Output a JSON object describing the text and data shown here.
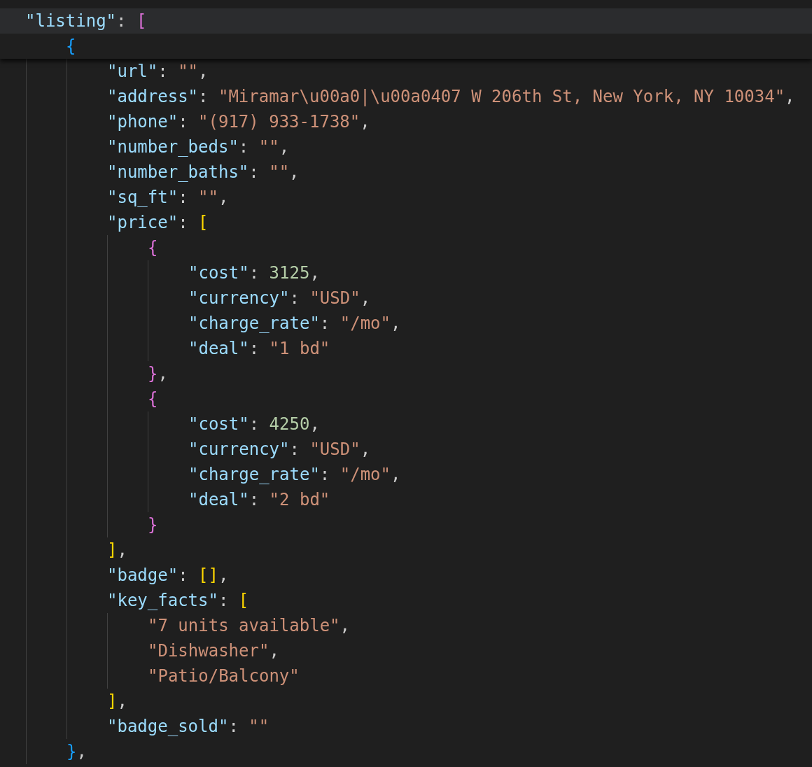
{
  "sticky_lines": [
    {
      "tokens": [
        {
          "text": "\"listing\"",
          "kind": "key"
        },
        {
          "text": ": ",
          "kind": "punct"
        },
        {
          "text": "[",
          "kind": "bracket",
          "color": "#da70d6"
        }
      ]
    },
    {
      "tokens": [
        {
          "text": "{",
          "kind": "bracket",
          "color": "#179fff"
        }
      ]
    }
  ],
  "lines": [
    {
      "tokens": [
        {
          "text": "\"url\"",
          "kind": "key"
        },
        {
          "text": ": ",
          "kind": "punct"
        },
        {
          "text": "\"\"",
          "kind": "string"
        },
        {
          "text": ",",
          "kind": "punct"
        }
      ]
    },
    {
      "tokens": [
        {
          "text": "\"address\"",
          "kind": "key"
        },
        {
          "text": ": ",
          "kind": "punct"
        },
        {
          "text": "\"Miramar\\u00a0|\\u00a0407 W 206th St, New York, NY 10034\"",
          "kind": "string"
        },
        {
          "text": ",",
          "kind": "punct"
        }
      ]
    },
    {
      "tokens": [
        {
          "text": "\"phone\"",
          "kind": "key"
        },
        {
          "text": ": ",
          "kind": "punct"
        },
        {
          "text": "\"(917) 933-1738\"",
          "kind": "string"
        },
        {
          "text": ",",
          "kind": "punct"
        }
      ]
    },
    {
      "tokens": [
        {
          "text": "\"number_beds\"",
          "kind": "key"
        },
        {
          "text": ": ",
          "kind": "punct"
        },
        {
          "text": "\"\"",
          "kind": "string"
        },
        {
          "text": ",",
          "kind": "punct"
        }
      ]
    },
    {
      "tokens": [
        {
          "text": "\"number_baths\"",
          "kind": "key"
        },
        {
          "text": ": ",
          "kind": "punct"
        },
        {
          "text": "\"\"",
          "kind": "string"
        },
        {
          "text": ",",
          "kind": "punct"
        }
      ]
    },
    {
      "tokens": [
        {
          "text": "\"sq_ft\"",
          "kind": "key"
        },
        {
          "text": ": ",
          "kind": "punct"
        },
        {
          "text": "\"\"",
          "kind": "string"
        },
        {
          "text": ",",
          "kind": "punct"
        }
      ]
    },
    {
      "tokens": [
        {
          "text": "\"price\"",
          "kind": "key"
        },
        {
          "text": ": ",
          "kind": "punct"
        },
        {
          "text": "[",
          "kind": "bracket",
          "color": "#ffd700"
        }
      ],
      "children": [
        {
          "tokens": [
            {
              "text": "{",
              "kind": "bracket",
              "color": "#da70d6"
            }
          ],
          "children": [
            {
              "tokens": [
                {
                  "text": "\"cost\"",
                  "kind": "key"
                },
                {
                  "text": ": ",
                  "kind": "punct"
                },
                {
                  "text": "3125",
                  "kind": "number"
                },
                {
                  "text": ",",
                  "kind": "punct"
                }
              ]
            },
            {
              "tokens": [
                {
                  "text": "\"currency\"",
                  "kind": "key"
                },
                {
                  "text": ": ",
                  "kind": "punct"
                },
                {
                  "text": "\"USD\"",
                  "kind": "string"
                },
                {
                  "text": ",",
                  "kind": "punct"
                }
              ]
            },
            {
              "tokens": [
                {
                  "text": "\"charge_rate\"",
                  "kind": "key"
                },
                {
                  "text": ": ",
                  "kind": "punct"
                },
                {
                  "text": "\"/mo\"",
                  "kind": "string"
                },
                {
                  "text": ",",
                  "kind": "punct"
                }
              ]
            },
            {
              "tokens": [
                {
                  "text": "\"deal\"",
                  "kind": "key"
                },
                {
                  "text": ": ",
                  "kind": "punct"
                },
                {
                  "text": "\"1 bd\"",
                  "kind": "string"
                }
              ]
            }
          ]
        },
        {
          "tokens": [
            {
              "text": "}",
              "kind": "bracket",
              "color": "#da70d6"
            },
            {
              "text": ",",
              "kind": "punct"
            }
          ]
        },
        {
          "tokens": [
            {
              "text": "{",
              "kind": "bracket",
              "color": "#da70d6"
            }
          ],
          "children": [
            {
              "tokens": [
                {
                  "text": "\"cost\"",
                  "kind": "key"
                },
                {
                  "text": ": ",
                  "kind": "punct"
                },
                {
                  "text": "4250",
                  "kind": "number"
                },
                {
                  "text": ",",
                  "kind": "punct"
                }
              ]
            },
            {
              "tokens": [
                {
                  "text": "\"currency\"",
                  "kind": "key"
                },
                {
                  "text": ": ",
                  "kind": "punct"
                },
                {
                  "text": "\"USD\"",
                  "kind": "string"
                },
                {
                  "text": ",",
                  "kind": "punct"
                }
              ]
            },
            {
              "tokens": [
                {
                  "text": "\"charge_rate\"",
                  "kind": "key"
                },
                {
                  "text": ": ",
                  "kind": "punct"
                },
                {
                  "text": "\"/mo\"",
                  "kind": "string"
                },
                {
                  "text": ",",
                  "kind": "punct"
                }
              ]
            },
            {
              "tokens": [
                {
                  "text": "\"deal\"",
                  "kind": "key"
                },
                {
                  "text": ": ",
                  "kind": "punct"
                },
                {
                  "text": "\"2 bd\"",
                  "kind": "string"
                }
              ]
            }
          ]
        },
        {
          "tokens": [
            {
              "text": "}",
              "kind": "bracket",
              "color": "#da70d6"
            }
          ]
        }
      ]
    },
    {
      "tokens": [
        {
          "text": "]",
          "kind": "bracket",
          "color": "#ffd700"
        },
        {
          "text": ",",
          "kind": "punct"
        }
      ]
    },
    {
      "tokens": [
        {
          "text": "\"badge\"",
          "kind": "key"
        },
        {
          "text": ": ",
          "kind": "punct"
        },
        {
          "text": "[]",
          "kind": "bracket",
          "color": "#ffd700"
        },
        {
          "text": ",",
          "kind": "punct"
        }
      ]
    },
    {
      "tokens": [
        {
          "text": "\"key_facts\"",
          "kind": "key"
        },
        {
          "text": ": ",
          "kind": "punct"
        },
        {
          "text": "[",
          "kind": "bracket",
          "color": "#ffd700"
        }
      ],
      "children": [
        {
          "tokens": [
            {
              "text": "\"7 units available\"",
              "kind": "string"
            },
            {
              "text": ",",
              "kind": "punct"
            }
          ]
        },
        {
          "tokens": [
            {
              "text": "\"Dishwasher\"",
              "kind": "string"
            },
            {
              "text": ",",
              "kind": "punct"
            }
          ]
        },
        {
          "tokens": [
            {
              "text": "\"Patio/Balcony\"",
              "kind": "string"
            }
          ]
        }
      ]
    },
    {
      "tokens": [
        {
          "text": "]",
          "kind": "bracket",
          "color": "#ffd700"
        },
        {
          "text": ",",
          "kind": "punct"
        }
      ]
    },
    {
      "tokens": [
        {
          "text": "\"badge_sold\"",
          "kind": "key"
        },
        {
          "text": ": ",
          "kind": "punct"
        },
        {
          "text": "\"\"",
          "kind": "string"
        }
      ]
    }
  ],
  "trailing_lines": [
    {
      "tokens": [
        {
          "text": "}",
          "kind": "bracket",
          "color": "#179fff"
        },
        {
          "text": ",",
          "kind": "punct"
        }
      ]
    }
  ]
}
